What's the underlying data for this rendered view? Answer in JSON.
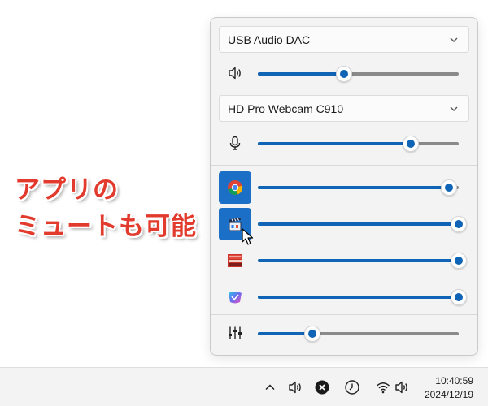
{
  "caption": {
    "line1": "アプリの",
    "line2": "ミュートも可能"
  },
  "output": {
    "device": "USB Audio DAC",
    "volume_icon": "speaker-icon",
    "level": 0.43
  },
  "input": {
    "device": "HD Pro Webcam C910",
    "mic_icon": "microphone-icon",
    "level": 0.76
  },
  "apps": [
    {
      "name": "chrome-app",
      "icon": "chrome-icon",
      "level": 0.95,
      "selected": true
    },
    {
      "name": "media-app",
      "icon": "clapperboard-icon",
      "level": 1.0,
      "selected": true
    },
    {
      "name": "video-app",
      "icon": "video-thumbnail-icon",
      "level": 1.0,
      "selected": false
    },
    {
      "name": "gradient-app",
      "icon": "colorful-app-icon",
      "level": 1.0,
      "selected": false
    }
  ],
  "mixer": {
    "icon": "mixer-sliders-icon",
    "level": 0.27
  },
  "taskbar": {
    "time": "10:40:59",
    "date": "2024/12/19",
    "icons": [
      "chevron-up-icon",
      "speaker-icon",
      "close-circle-icon",
      "clock-icon",
      "wifi-icon",
      "speaker-icon"
    ]
  },
  "colors": {
    "accent": "#0f64b5",
    "caption": "#e23a2c"
  }
}
